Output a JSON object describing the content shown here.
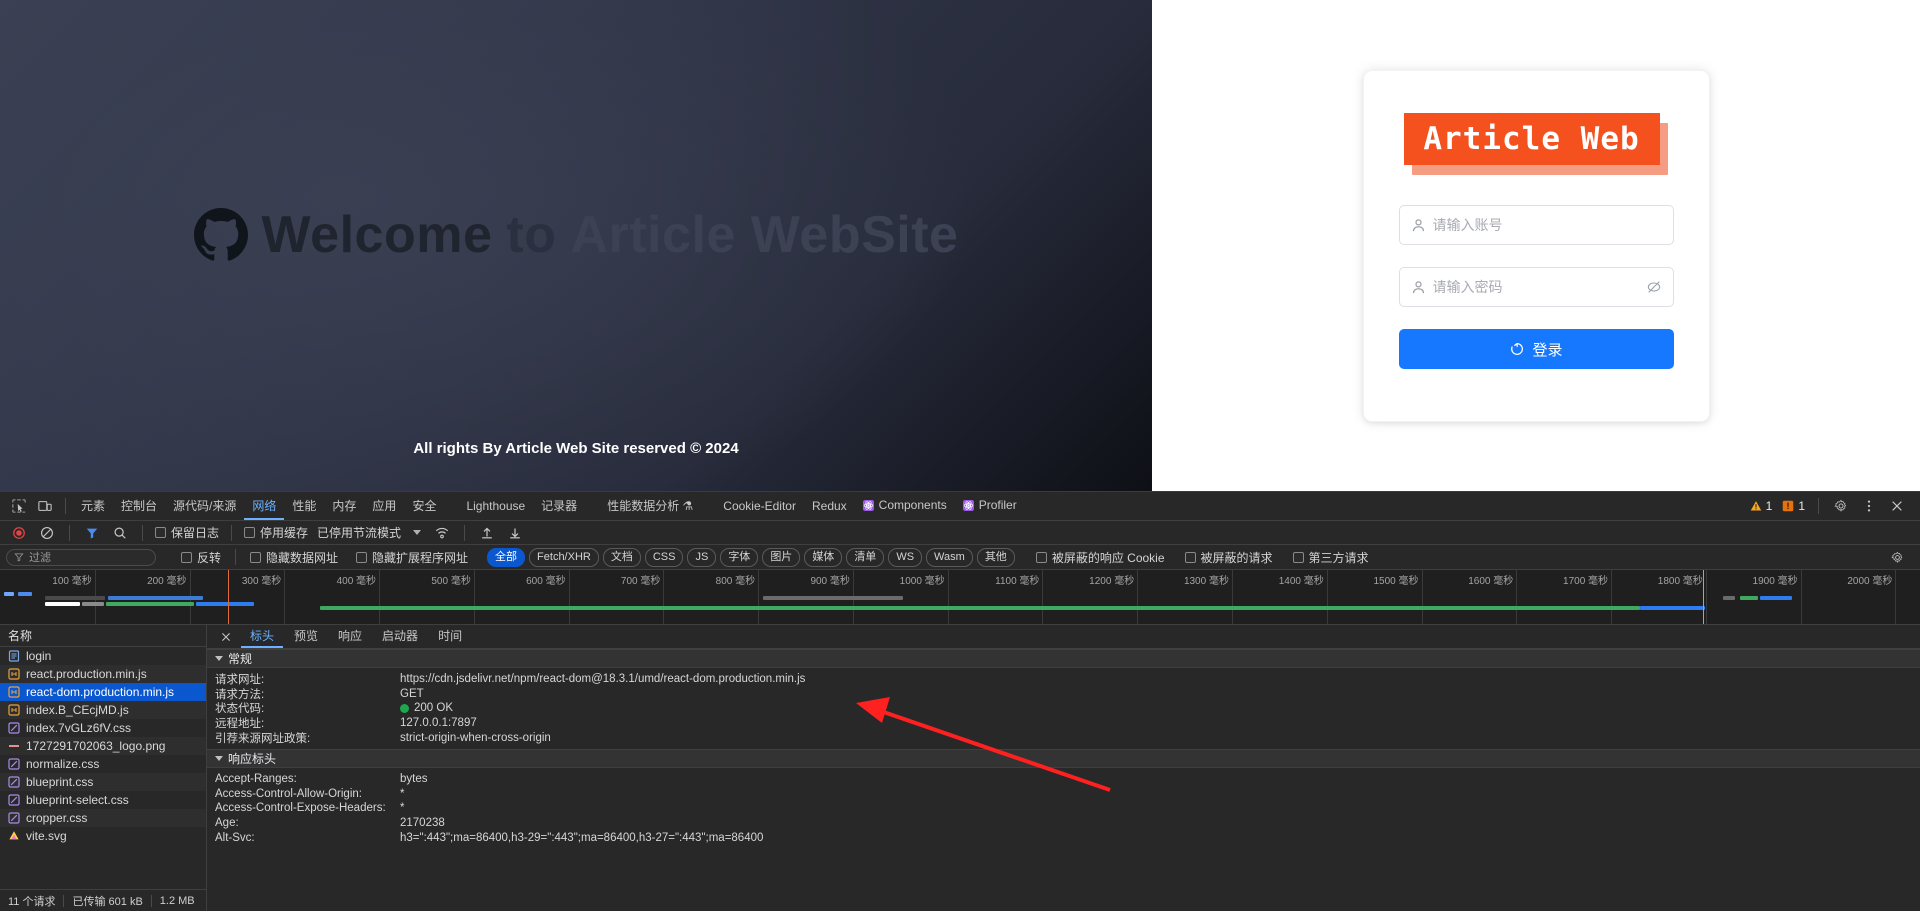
{
  "page": {
    "hero": {
      "icon": "github-icon",
      "text_part1": "Welcome",
      "text_part2": "to",
      "text_part3": "Article WebSite",
      "footer": "All rights By Article Web Site reserved © 2024"
    },
    "login": {
      "brand": "Article Web",
      "username_placeholder": "请输入账号",
      "password_placeholder": "请输入密码",
      "username_value": "",
      "password_value": "",
      "submit_label": "登录"
    }
  },
  "devtools": {
    "tabs": [
      {
        "label": "元素",
        "selected": false
      },
      {
        "label": "控制台",
        "selected": false
      },
      {
        "label": "源代码/来源",
        "selected": false
      },
      {
        "label": "网络",
        "selected": true
      },
      {
        "label": "性能",
        "selected": false
      },
      {
        "label": "内存",
        "selected": false
      },
      {
        "label": "应用",
        "selected": false
      },
      {
        "label": "安全",
        "selected": false
      },
      {
        "label": "Lighthouse",
        "selected": false
      },
      {
        "label": "记录器",
        "selected": false
      },
      {
        "label": "性能数据分析 ⚗",
        "selected": false
      },
      {
        "label": "Cookie-Editor",
        "selected": false
      },
      {
        "label": "Redux",
        "selected": false
      },
      {
        "label": "Components",
        "selected": false
      },
      {
        "label": "Profiler",
        "selected": false
      }
    ],
    "status": {
      "warnings": "1",
      "errors": "1"
    },
    "toolbar": {
      "preserve_log": "保留日志",
      "disable_cache": "停用缓存",
      "throttling": "已停用节流模式"
    },
    "filterbar": {
      "filter_placeholder": "过滤",
      "filter_value": "",
      "invert": "反转",
      "hide_data_urls": "隐藏数据网址",
      "hide_ext_urls": "隐藏扩展程序网址",
      "types": [
        {
          "label": "全部",
          "selected": true
        },
        {
          "label": "Fetch/XHR",
          "selected": false
        },
        {
          "label": "文档",
          "selected": false
        },
        {
          "label": "CSS",
          "selected": false
        },
        {
          "label": "JS",
          "selected": false
        },
        {
          "label": "字体",
          "selected": false
        },
        {
          "label": "图片",
          "selected": false
        },
        {
          "label": "媒体",
          "selected": false
        },
        {
          "label": "清单",
          "selected": false
        },
        {
          "label": "WS",
          "selected": false
        },
        {
          "label": "Wasm",
          "selected": false
        },
        {
          "label": "其他",
          "selected": false
        }
      ],
      "blocked_cookies": "被屏蔽的响应 Cookie",
      "blocked_requests": "被屏蔽的请求",
      "third_party": "第三方请求"
    },
    "overview": {
      "unit": "毫秒",
      "ticks": [
        100,
        200,
        300,
        400,
        500,
        600,
        700,
        800,
        900,
        1000,
        1100,
        1200,
        1300,
        1400,
        1500,
        1600,
        1700,
        1800,
        1900,
        2000
      ]
    },
    "requests": {
      "header": "名称",
      "rows": [
        {
          "name": "login",
          "type": "doc",
          "selected": false
        },
        {
          "name": "react.production.min.js",
          "type": "js",
          "selected": false
        },
        {
          "name": "react-dom.production.min.js",
          "type": "js",
          "selected": true
        },
        {
          "name": "index.B_CEcjMD.js",
          "type": "js",
          "selected": false
        },
        {
          "name": "index.7vGLz6fV.css",
          "type": "css",
          "selected": false
        },
        {
          "name": "1727291702063_logo.png",
          "type": "img",
          "selected": false
        },
        {
          "name": "normalize.css",
          "type": "css",
          "selected": false
        },
        {
          "name": "blueprint.css",
          "type": "css",
          "selected": false
        },
        {
          "name": "blueprint-select.css",
          "type": "css",
          "selected": false
        },
        {
          "name": "cropper.css",
          "type": "css",
          "selected": false
        },
        {
          "name": "vite.svg",
          "type": "svg",
          "selected": false
        }
      ],
      "footer": {
        "count": "11 个请求",
        "transferred": "已传输 601 kB",
        "resources": "1.2 MB"
      }
    },
    "detail": {
      "tabs": [
        {
          "label": "标头",
          "selected": true
        },
        {
          "label": "预览",
          "selected": false
        },
        {
          "label": "响应",
          "selected": false
        },
        {
          "label": "启动器",
          "selected": false
        },
        {
          "label": "时间",
          "selected": false
        }
      ],
      "general": {
        "title": "常规",
        "rows": [
          {
            "key": "请求网址:",
            "value": "https://cdn.jsdelivr.net/npm/react-dom@18.3.1/umd/react-dom.production.min.js",
            "status": false
          },
          {
            "key": "请求方法:",
            "value": "GET",
            "status": false
          },
          {
            "key": "状态代码:",
            "value": "200 OK",
            "status": true
          },
          {
            "key": "远程地址:",
            "value": "127.0.0.1:7897",
            "status": false
          },
          {
            "key": "引荐来源网址政策:",
            "value": "strict-origin-when-cross-origin",
            "status": false
          }
        ]
      },
      "response_headers": {
        "title": "响应标头",
        "rows": [
          {
            "key": "Accept-Ranges:",
            "value": "bytes"
          },
          {
            "key": "Access-Control-Allow-Origin:",
            "value": "*"
          },
          {
            "key": "Access-Control-Expose-Headers:",
            "value": "*"
          },
          {
            "key": "Age:",
            "value": "2170238"
          },
          {
            "key": "Alt-Svc:",
            "value": "h3=\":443\";ma=86400,h3-29=\":443\";ma=86400,h3-27=\":443\";ma=86400"
          }
        ]
      }
    }
  },
  "colors": {
    "brand_orange": "#f4511e",
    "primary_blue": "#1677ff",
    "devtools_accent": "#6cb1ff",
    "selected_row": "#0b57d0",
    "status_green": "#1ea84c",
    "annotation_red": "#ff2020"
  }
}
